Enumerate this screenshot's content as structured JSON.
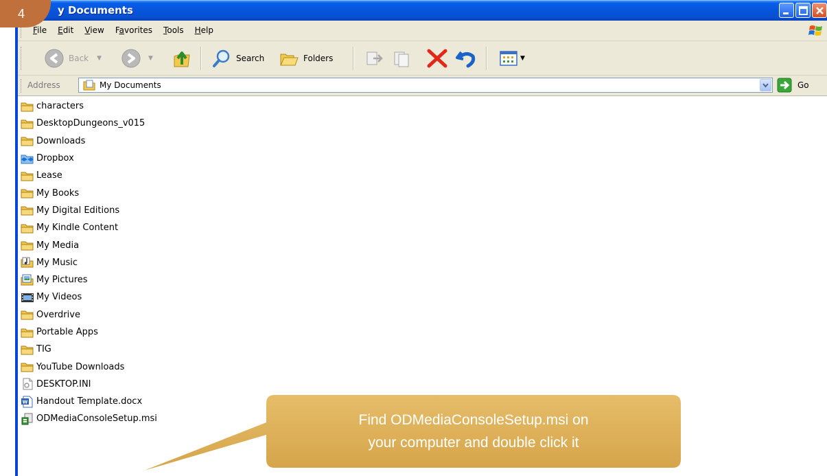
{
  "step_number": "4",
  "window": {
    "title": "My Documents",
    "title_visible": "y Documents"
  },
  "menu": {
    "items": [
      {
        "label": "File",
        "mnemonic": "F"
      },
      {
        "label": "Edit",
        "mnemonic": "E"
      },
      {
        "label": "View",
        "mnemonic": "V"
      },
      {
        "label": "Favorites",
        "mnemonic": "a"
      },
      {
        "label": "Tools",
        "mnemonic": "T"
      },
      {
        "label": "Help",
        "mnemonic": "H"
      }
    ]
  },
  "toolbar": {
    "back_label": "Back",
    "search_label": "Search",
    "folders_label": "Folders"
  },
  "address": {
    "label": "Address",
    "value": "My Documents",
    "go_label": "Go"
  },
  "files": [
    {
      "name": "characters",
      "icon": "folder-icon"
    },
    {
      "name": "DesktopDungeons_v015",
      "icon": "folder-icon"
    },
    {
      "name": "Downloads",
      "icon": "folder-icon"
    },
    {
      "name": "Dropbox",
      "icon": "dropbox-folder-icon"
    },
    {
      "name": "Lease",
      "icon": "folder-icon"
    },
    {
      "name": "My Books",
      "icon": "folder-icon"
    },
    {
      "name": "My Digital Editions",
      "icon": "folder-icon"
    },
    {
      "name": "My Kindle Content",
      "icon": "folder-icon"
    },
    {
      "name": "My Media",
      "icon": "folder-icon"
    },
    {
      "name": "My Music",
      "icon": "music-folder-icon"
    },
    {
      "name": "My Pictures",
      "icon": "pictures-folder-icon"
    },
    {
      "name": "My Videos",
      "icon": "videos-folder-icon"
    },
    {
      "name": "Overdrive",
      "icon": "folder-icon"
    },
    {
      "name": "Portable Apps",
      "icon": "folder-icon"
    },
    {
      "name": "TIG",
      "icon": "folder-icon"
    },
    {
      "name": "YouTube Downloads",
      "icon": "folder-icon"
    },
    {
      "name": "DESKTOP.INI",
      "icon": "ini-file-icon"
    },
    {
      "name": "Handout Template.docx",
      "icon": "word-document-icon"
    },
    {
      "name": "ODMediaConsoleSetup.msi",
      "icon": "msi-installer-icon"
    }
  ],
  "callout": {
    "line1": "Find ODMediaConsoleSetup.msi on",
    "line2": "your computer and double click it"
  },
  "colors": {
    "titlebar": "#0a5ee6",
    "chrome": "#ece9d8",
    "callout": "#dcae52",
    "badge": "#c0703a"
  }
}
